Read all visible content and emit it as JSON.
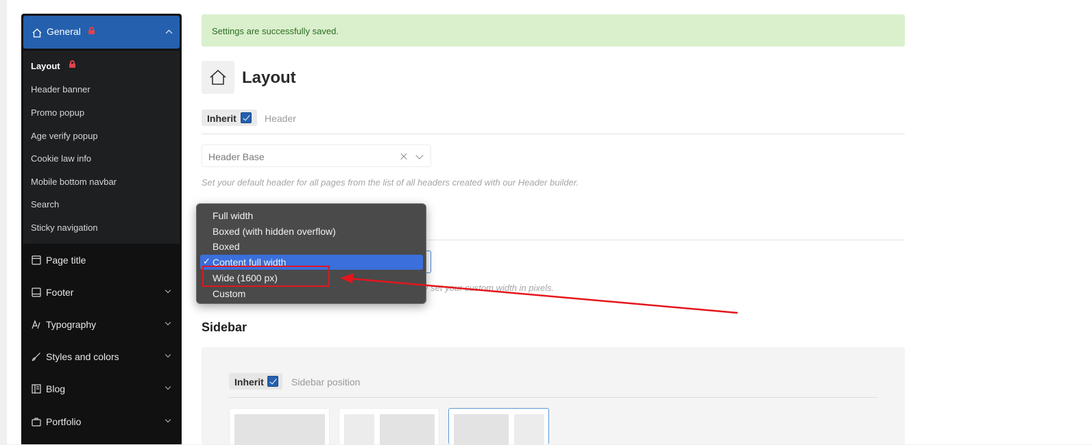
{
  "sidebar": {
    "general": {
      "label": "General"
    },
    "sub_items": [
      {
        "label": "Layout",
        "active": true
      },
      {
        "label": "Header banner"
      },
      {
        "label": "Promo popup"
      },
      {
        "label": "Age verify popup"
      },
      {
        "label": "Cookie law info"
      },
      {
        "label": "Mobile bottom navbar"
      },
      {
        "label": "Search"
      },
      {
        "label": "Sticky navigation"
      }
    ],
    "nav_items": [
      {
        "label": "Page title",
        "icon": "page-title-icon"
      },
      {
        "label": "Footer",
        "icon": "footer-icon"
      },
      {
        "label": "Typography",
        "icon": "typography-icon"
      },
      {
        "label": "Styles and colors",
        "icon": "brush-icon"
      },
      {
        "label": "Blog",
        "icon": "blog-icon"
      },
      {
        "label": "Portfolio",
        "icon": "briefcase-icon"
      }
    ]
  },
  "notice": {
    "text": "Settings are successfully saved."
  },
  "page": {
    "title": "Layout"
  },
  "header_field": {
    "inherit_label": "Inherit",
    "label": "Header",
    "value": "Header Base",
    "help": "Set your default header for all pages from the list of all headers created with our Header builder."
  },
  "site_width": {
    "help_tail": "/ set your custom width in pixels.",
    "options": [
      "Full width",
      "Boxed (with hidden overflow)",
      "Boxed",
      "Content full width",
      "Wide (1600 px)",
      "Custom"
    ],
    "selected": "Content full width",
    "check_glyph": "✓"
  },
  "sidebar_section": {
    "title": "Sidebar",
    "inherit_label": "Inherit",
    "label": "Sidebar position"
  },
  "colors": {
    "accent": "#2460ae",
    "notice_bg": "#daf0cd",
    "annotation": "#e4161c",
    "dropdown_selected": "#3a6fdc"
  }
}
